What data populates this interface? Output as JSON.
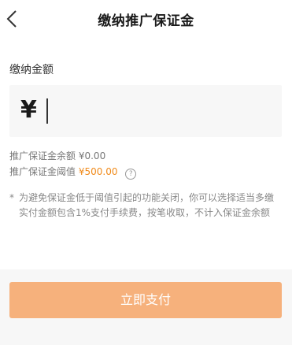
{
  "header": {
    "title": "缴纳推广保证金",
    "back_icon": "chevron-left-icon"
  },
  "form": {
    "amount_label": "缴纳金额",
    "currency_symbol": "¥",
    "amount_value": ""
  },
  "info": {
    "balance_label": "推广保证金余额",
    "balance_value": "¥0.00",
    "threshold_label": "推广保证金阈值",
    "threshold_value": "¥500.00",
    "help_icon": "question-circle-icon",
    "help_glyph": "?"
  },
  "notes": {
    "star": "*",
    "line1": "为避免保证金低于阈值引起的功能关闭，你可以选择适当多缴",
    "line2": "实付金额包含1%支付手续费，按笔收取，不计入保证金余额"
  },
  "footer": {
    "pay_button_label": "立即支付"
  },
  "colors": {
    "accent_orange": "#f08a1a",
    "pay_button": "#f6b17c",
    "input_bg": "#f7f7f7"
  }
}
